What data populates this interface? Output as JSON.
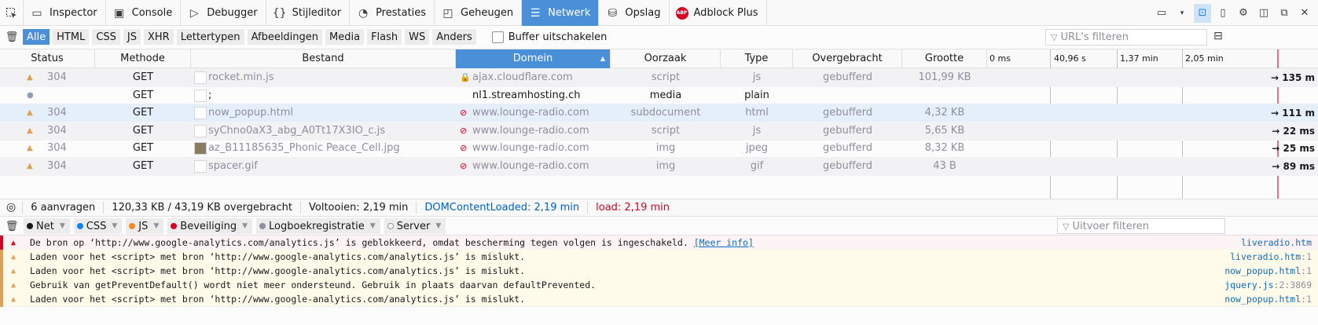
{
  "toolbar": {
    "tools": [
      {
        "label": "Inspector",
        "icon": "inspector-icon",
        "glyph": "▭"
      },
      {
        "label": "Console",
        "icon": "console-icon",
        "glyph": "▣"
      },
      {
        "label": "Debugger",
        "icon": "debugger-icon",
        "glyph": "▷"
      },
      {
        "label": "Stijleditor",
        "icon": "style-editor-icon",
        "glyph": "{}"
      },
      {
        "label": "Prestaties",
        "icon": "performance-icon",
        "glyph": "◔"
      },
      {
        "label": "Geheugen",
        "icon": "memory-icon",
        "glyph": "◰"
      },
      {
        "label": "Netwerk",
        "icon": "network-icon",
        "glyph": "☰"
      },
      {
        "label": "Opslag",
        "icon": "storage-icon",
        "glyph": "⛁"
      },
      {
        "label": "Adblock Plus",
        "icon": "adblock-icon",
        "glyph": "ABP"
      }
    ],
    "active_index": 6
  },
  "filters": {
    "types": [
      "Alle",
      "HTML",
      "CSS",
      "JS",
      "XHR",
      "Lettertypen",
      "Afbeeldingen",
      "Media",
      "Flash",
      "WS",
      "Anders"
    ],
    "active_index": 0,
    "buffer_label": "Buffer uitschakelen",
    "url_placeholder": "URL's filteren"
  },
  "columns": {
    "status": "Status",
    "method": "Methode",
    "file": "Bestand",
    "domain": "Domein",
    "cause": "Oorzaak",
    "type": "Type",
    "transferred": "Overgebracht",
    "size": "Grootte"
  },
  "timeline_ticks": [
    "0 ms",
    "40,96 s",
    "1,37 min",
    "2,05 min"
  ],
  "requests": [
    {
      "status": "304",
      "marker": "warning",
      "method": "GET",
      "file": "rocket.min.js",
      "domain": "ajax.cloudflare.com",
      "security": "secure",
      "cause": "script",
      "type": "js",
      "transferred": "gebufferd",
      "size": "101,99 KB",
      "time": "→ 135 m",
      "thumb": "blank"
    },
    {
      "status": "",
      "marker": "dot",
      "method": "GET",
      "file": ";",
      "domain": "nl1.streamhosting.ch",
      "security": "none",
      "cause": "media",
      "type": "plain",
      "transferred": "",
      "size": "",
      "time": "",
      "thumb": "blank"
    },
    {
      "status": "304",
      "marker": "warning",
      "method": "GET",
      "file": "now_popup.html",
      "domain": "www.lounge-radio.com",
      "security": "insecure",
      "cause": "subdocument",
      "type": "html",
      "transferred": "gebufferd",
      "size": "4,32 KB",
      "time": "→ 111 m",
      "thumb": "blank"
    },
    {
      "status": "304",
      "marker": "warning",
      "method": "GET",
      "file": "syChno0aX3_abg_A0Tt17X3IO_c.js",
      "domain": "www.lounge-radio.com",
      "security": "insecure",
      "cause": "script",
      "type": "js",
      "transferred": "gebufferd",
      "size": "5,65 KB",
      "time": "→ 22 ms",
      "thumb": "blank"
    },
    {
      "status": "304",
      "marker": "warning",
      "method": "GET",
      "file": "az_B11185635_Phonic Peace_Cell.jpg",
      "domain": "www.lounge-radio.com",
      "security": "insecure",
      "cause": "img",
      "type": "jpeg",
      "transferred": "gebufferd",
      "size": "8,32 KB",
      "time": "→ 25 ms",
      "thumb": "image"
    },
    {
      "status": "304",
      "marker": "warning",
      "method": "GET",
      "file": "spacer.gif",
      "domain": "www.lounge-radio.com",
      "security": "insecure",
      "cause": "img",
      "type": "gif",
      "transferred": "gebufferd",
      "size": "43 B",
      "time": "→ 89 ms",
      "thumb": "blank"
    }
  ],
  "summary": {
    "requests": "6 aanvragen",
    "transferred": "120,33 KB / 43,19 KB overgebracht",
    "finish": "Voltooien: 2,19 min",
    "dom": "DOMContentLoaded: 2,19 min",
    "load": "load: 2,19 min"
  },
  "console_filters": [
    {
      "label": "Net",
      "color": "#18191a"
    },
    {
      "label": "CSS",
      "color": "#0a84ff"
    },
    {
      "label": "JS",
      "color": "#f08a24"
    },
    {
      "label": "Beveiliging",
      "color": "#d70022"
    },
    {
      "label": "Logboekregistratie",
      "color": "#8f8f9d"
    },
    {
      "label": "Server",
      "color": "#ffffff"
    }
  ],
  "console_filter_placeholder": "Uitvoer filteren",
  "console": [
    {
      "level": "error",
      "message": "De bron op ‘http://www.google-analytics.com/analytics.js’ is geblokkeerd, omdat bescherming tegen volgen is ingeschakeld.",
      "link": "[Meer info]",
      "source": "liveradio.htm",
      "line": ""
    },
    {
      "level": "warning",
      "message": "Laden voor het <script> met bron ‘http://www.google-analytics.com/analytics.js’ is mislukt.",
      "link": "",
      "source": "liveradio.htm",
      "line": ":1"
    },
    {
      "level": "warning",
      "message": "Laden voor het <script> met bron ‘http://www.google-analytics.com/analytics.js’ is mislukt.",
      "link": "",
      "source": "now_popup.html",
      "line": ":1"
    },
    {
      "level": "warning",
      "message": "Gebruik van getPreventDefault() wordt niet meer ondersteund. Gebruik in plaats daarvan defaultPrevented.",
      "link": "",
      "source": "jquery.js",
      "line": ":2:3869"
    },
    {
      "level": "warning",
      "message": "Laden voor het <script> met bron ‘http://www.google-analytics.com/analytics.js’ is mislukt.",
      "link": "",
      "source": "now_popup.html",
      "line": ":1"
    }
  ],
  "colors": {
    "accent": "#4a90d9",
    "error": "#d70022",
    "warning": "#e0a054"
  }
}
